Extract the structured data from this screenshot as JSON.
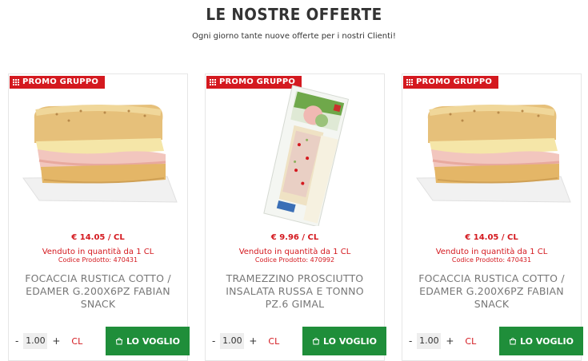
{
  "header": {
    "title": "LE NOSTRE OFFERTE",
    "subtitle": "Ogni giorno tante nuove offerte per i nostri Clienti!"
  },
  "colors": {
    "accent_red": "#d4191f",
    "cta_green": "#1f8e3a"
  },
  "products": [
    {
      "badge": "PROMO GRUPPO",
      "image": "focaccia-sandwich",
      "price": "€ 14.05 / CL",
      "sold": "Venduto in quantità da 1 CL",
      "code": "Codice Prodotto: 470431",
      "name": "FOCACCIA RUSTICA COTTO / EDAMER G.200X6PZ FABIAN SNACK",
      "qty_minus": "-",
      "qty": "1.00",
      "qty_plus": "+",
      "unit": "CL",
      "cta": "LO VOGLIO"
    },
    {
      "badge": "PROMO GRUPPO",
      "image": "packaged-tramezzino",
      "price": "€ 9.96 / CL",
      "sold": "Venduto in quantità da 1 CL",
      "code": "Codice Prodotto: 470992",
      "name": "TRAMEZZINO PROSCIUTTO INSALATA RUSSA E TONNO PZ.6 GIMAL",
      "qty_minus": "-",
      "qty": "1.00",
      "qty_plus": "+",
      "unit": "CL",
      "cta": "LO VOGLIO"
    },
    {
      "badge": "PROMO GRUPPO",
      "image": "focaccia-sandwich",
      "price": "€ 14.05 / CL",
      "sold": "Venduto in quantità da 1 CL",
      "code": "Codice Prodotto: 470431",
      "name": "FOCACCIA RUSTICA COTTO / EDAMER G.200X6PZ FABIAN SNACK",
      "qty_minus": "-",
      "qty": "1.00",
      "qty_plus": "+",
      "unit": "CL",
      "cta": "LO VOGLIO"
    }
  ]
}
